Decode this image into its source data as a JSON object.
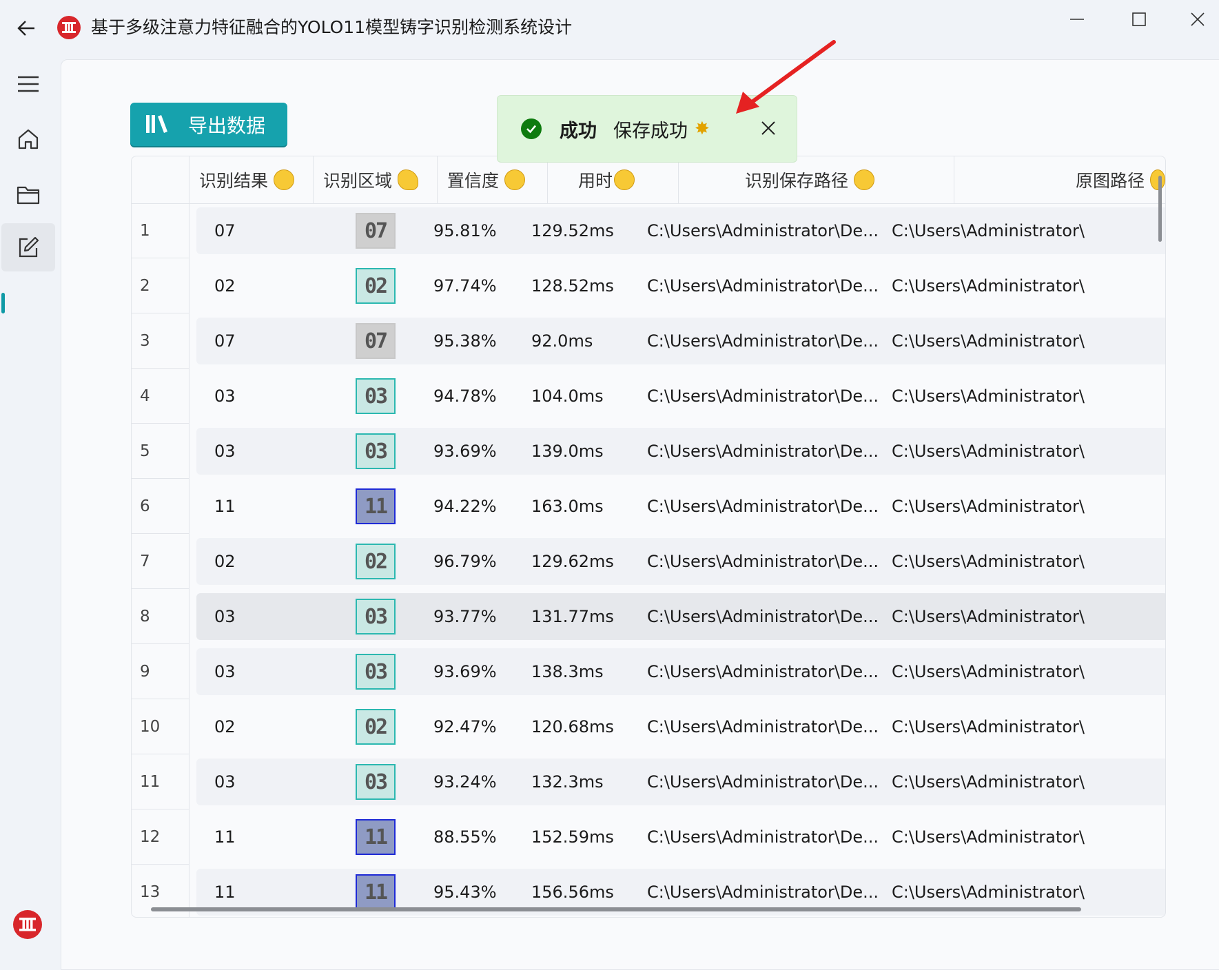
{
  "window": {
    "title": "基于多级注意力特征融合的YOLO11模型铸字识别检测系统设计",
    "back_icon": "arrow-left-icon",
    "app_icon": "red-circle-logo-icon",
    "controls": [
      "minimize-icon",
      "maximize-icon",
      "close-icon"
    ]
  },
  "sidebar": {
    "items": [
      {
        "icon": "hamburger-menu-icon"
      },
      {
        "icon": "home-icon"
      },
      {
        "icon": "folder-icon"
      },
      {
        "icon": "edit-icon",
        "active": true
      }
    ],
    "accent": "#0f9aa6"
  },
  "toolbar": {
    "export_label": "导出数据",
    "export_color": "#16a2ad"
  },
  "toast": {
    "title": "成功",
    "message": "保存成功",
    "spark": "✸",
    "status_color": "#0f7b0f"
  },
  "table": {
    "headers": {
      "result": "识别结果",
      "region": "识别区域",
      "confidence": "置信度",
      "time": "用时",
      "save_path": "识别保存路径",
      "orig_path": "原图路径"
    },
    "rows": [
      {
        "idx": "1",
        "result": "07",
        "thumb": "07",
        "color": "gray",
        "conf": "95.81%",
        "time": "129.52ms",
        "save": "C:\\Users\\Administrator\\De...",
        "orig": "C:\\Users\\Administrator\\"
      },
      {
        "idx": "2",
        "result": "02",
        "thumb": "02",
        "color": "teal",
        "conf": "97.74%",
        "time": "128.52ms",
        "save": "C:\\Users\\Administrator\\De...",
        "orig": "C:\\Users\\Administrator\\"
      },
      {
        "idx": "3",
        "result": "07",
        "thumb": "07",
        "color": "gray",
        "conf": "95.38%",
        "time": "92.0ms",
        "save": "C:\\Users\\Administrator\\De...",
        "orig": "C:\\Users\\Administrator\\"
      },
      {
        "idx": "4",
        "result": "03",
        "thumb": "03",
        "color": "teal",
        "conf": "94.78%",
        "time": "104.0ms",
        "save": "C:\\Users\\Administrator\\De...",
        "orig": "C:\\Users\\Administrator\\"
      },
      {
        "idx": "5",
        "result": "03",
        "thumb": "03",
        "color": "teal",
        "conf": "93.69%",
        "time": "139.0ms",
        "save": "C:\\Users\\Administrator\\De...",
        "orig": "C:\\Users\\Administrator\\"
      },
      {
        "idx": "6",
        "result": "11",
        "thumb": "11",
        "color": "blue",
        "conf": "94.22%",
        "time": "163.0ms",
        "save": "C:\\Users\\Administrator\\De...",
        "orig": "C:\\Users\\Administrator\\"
      },
      {
        "idx": "7",
        "result": "02",
        "thumb": "02",
        "color": "teal",
        "conf": "96.79%",
        "time": "129.62ms",
        "save": "C:\\Users\\Administrator\\De...",
        "orig": "C:\\Users\\Administrator\\"
      },
      {
        "idx": "8",
        "result": "03",
        "thumb": "03",
        "color": "teal",
        "conf": "93.77%",
        "time": "131.77ms",
        "save": "C:\\Users\\Administrator\\De...",
        "orig": "C:\\Users\\Administrator\\",
        "selected": true
      },
      {
        "idx": "9",
        "result": "03",
        "thumb": "03",
        "color": "teal",
        "conf": "93.69%",
        "time": "138.3ms",
        "save": "C:\\Users\\Administrator\\De...",
        "orig": "C:\\Users\\Administrator\\"
      },
      {
        "idx": "10",
        "result": "02",
        "thumb": "02",
        "color": "teal",
        "conf": "92.47%",
        "time": "120.68ms",
        "save": "C:\\Users\\Administrator\\De...",
        "orig": "C:\\Users\\Administrator\\"
      },
      {
        "idx": "11",
        "result": "03",
        "thumb": "03",
        "color": "teal",
        "conf": "93.24%",
        "time": "132.3ms",
        "save": "C:\\Users\\Administrator\\De...",
        "orig": "C:\\Users\\Administrator\\"
      },
      {
        "idx": "12",
        "result": "11",
        "thumb": "11",
        "color": "blue",
        "conf": "88.55%",
        "time": "152.59ms",
        "save": "C:\\Users\\Administrator\\De...",
        "orig": "C:\\Users\\Administrator\\"
      },
      {
        "idx": "13",
        "result": "11",
        "thumb": "11",
        "color": "blue",
        "conf": "95.43%",
        "time": "156.56ms",
        "save": "C:\\Users\\Administrator\\De...",
        "orig": "C:\\Users\\Administrator\\"
      }
    ]
  },
  "annotation": {
    "arrow_color": "#e52222"
  }
}
